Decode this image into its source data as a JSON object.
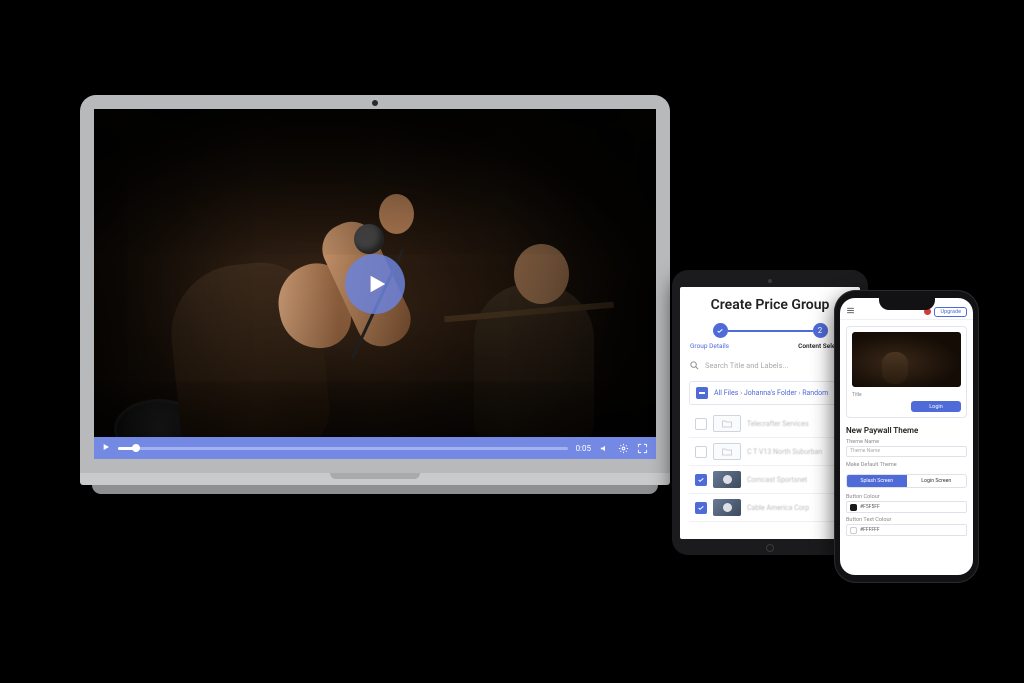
{
  "colors": {
    "accent": "#4f6bd8",
    "controlbar": "#7389e3"
  },
  "player": {
    "time": "0:05",
    "icons": {
      "play": "play-icon",
      "volume": "volume-icon",
      "settings": "settings-icon",
      "fullscreen": "fullscreen-icon"
    }
  },
  "tablet": {
    "title": "Create Price Group",
    "steps": [
      "Group Details",
      "Content Selection"
    ],
    "search_placeholder": "Search Title and Labels...",
    "breadcrumb": [
      "All Files",
      "Johanna's Folder",
      "Random"
    ],
    "rows": [
      {
        "checked": false,
        "type": "folder",
        "label": "Telecrafter Services"
      },
      {
        "checked": false,
        "type": "folder",
        "label": "C T V13 North Suburban"
      },
      {
        "checked": true,
        "type": "video",
        "label": "Comcast Sportsnet"
      },
      {
        "checked": true,
        "type": "video",
        "label": "Cable America Corp"
      }
    ]
  },
  "phone": {
    "upgrade": "Upgrade",
    "login": "Login",
    "preview_title": "Title",
    "section": "New Paywall Theme",
    "field_theme": "Theme Name",
    "theme_placeholder": "Theme Name",
    "make_default": "Make Default Theme",
    "tabs": [
      "Splash Screen",
      "Login Screen"
    ],
    "button_colour_label": "Button Colour",
    "button_colour_value": "#F5F5FF",
    "button_text_label": "Button Text Colour",
    "button_text_value": "#FFFFFF"
  }
}
